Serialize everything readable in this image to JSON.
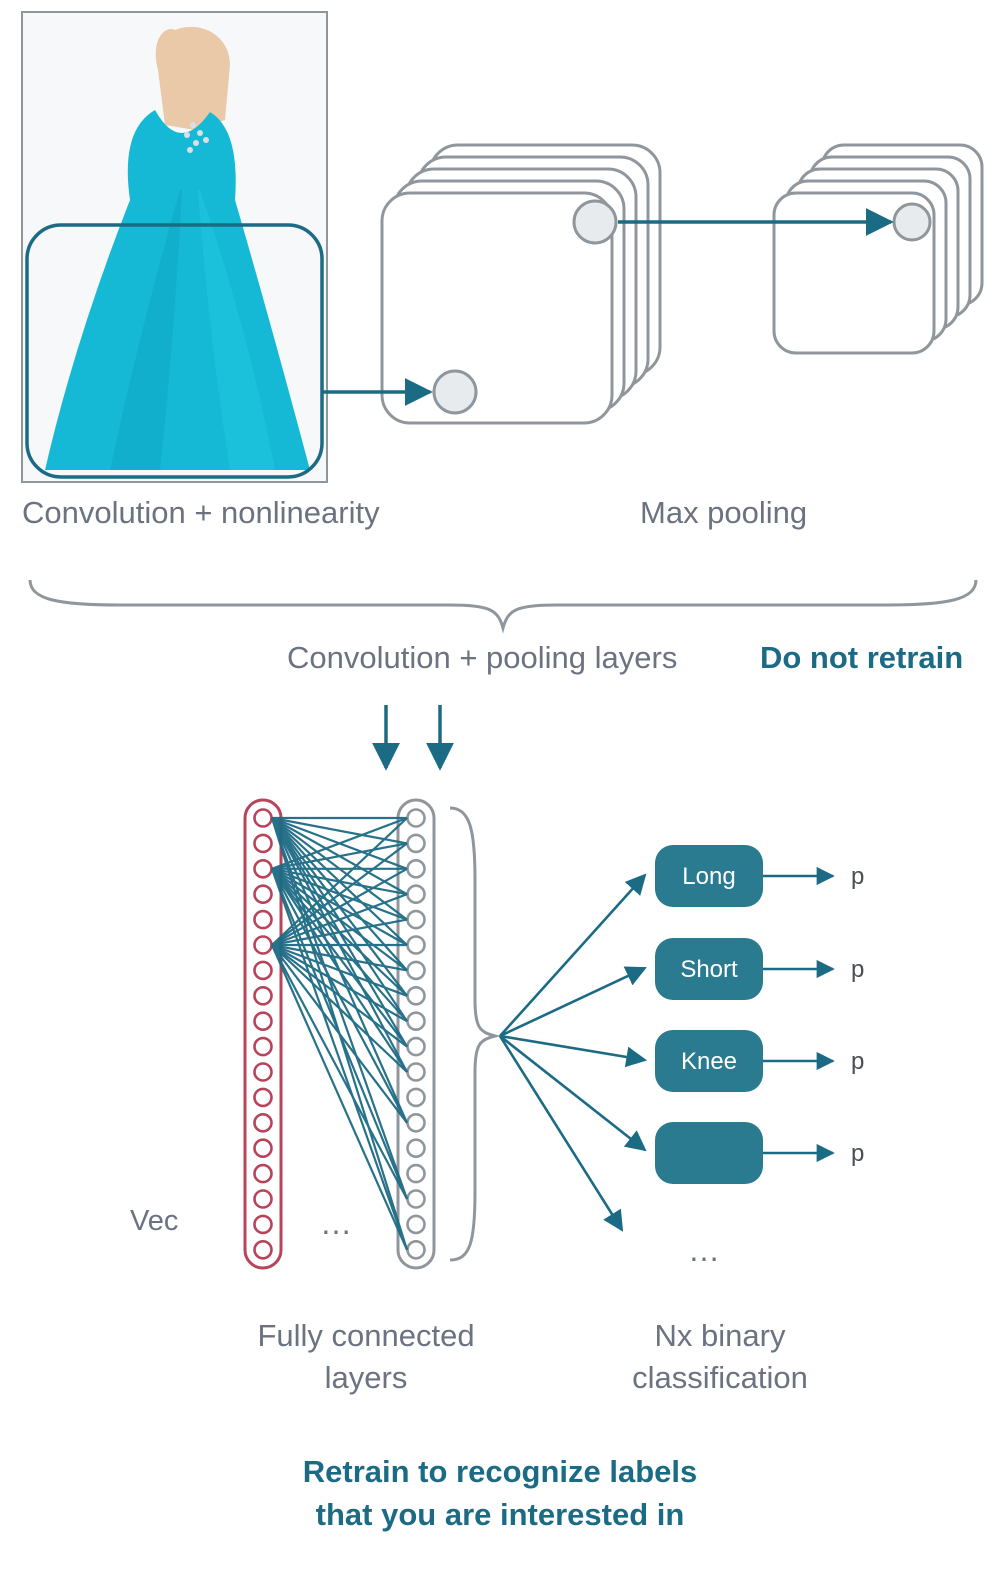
{
  "labels": {
    "conv_nonlin": "Convolution + nonlinearity",
    "max_pool": "Max pooling",
    "conv_pool_layers": "Convolution + pooling layers",
    "do_not_retrain": "Do not retrain",
    "vec": "Vec",
    "fc_ellipsis": "…",
    "fc_layers_l1": "Fully connected",
    "fc_layers_l2": "layers",
    "nx_l1": "Nx binary",
    "nx_l2": "classification",
    "retrain_l1": "Retrain to recognize labels",
    "retrain_l2": "that you are interested in",
    "cls_ellipsis": "…"
  },
  "classes": [
    {
      "name": "Long",
      "p": "p"
    },
    {
      "name": "Short",
      "p": "p"
    },
    {
      "name": "Knee",
      "p": "p"
    },
    {
      "name": "",
      "p": "p"
    }
  ],
  "colors": {
    "teal": "#2a7a90",
    "teal_stroke": "#1c6b84",
    "gray_stroke": "#8f969c",
    "pink": "#b7445a",
    "dress": "#15b9d6"
  }
}
